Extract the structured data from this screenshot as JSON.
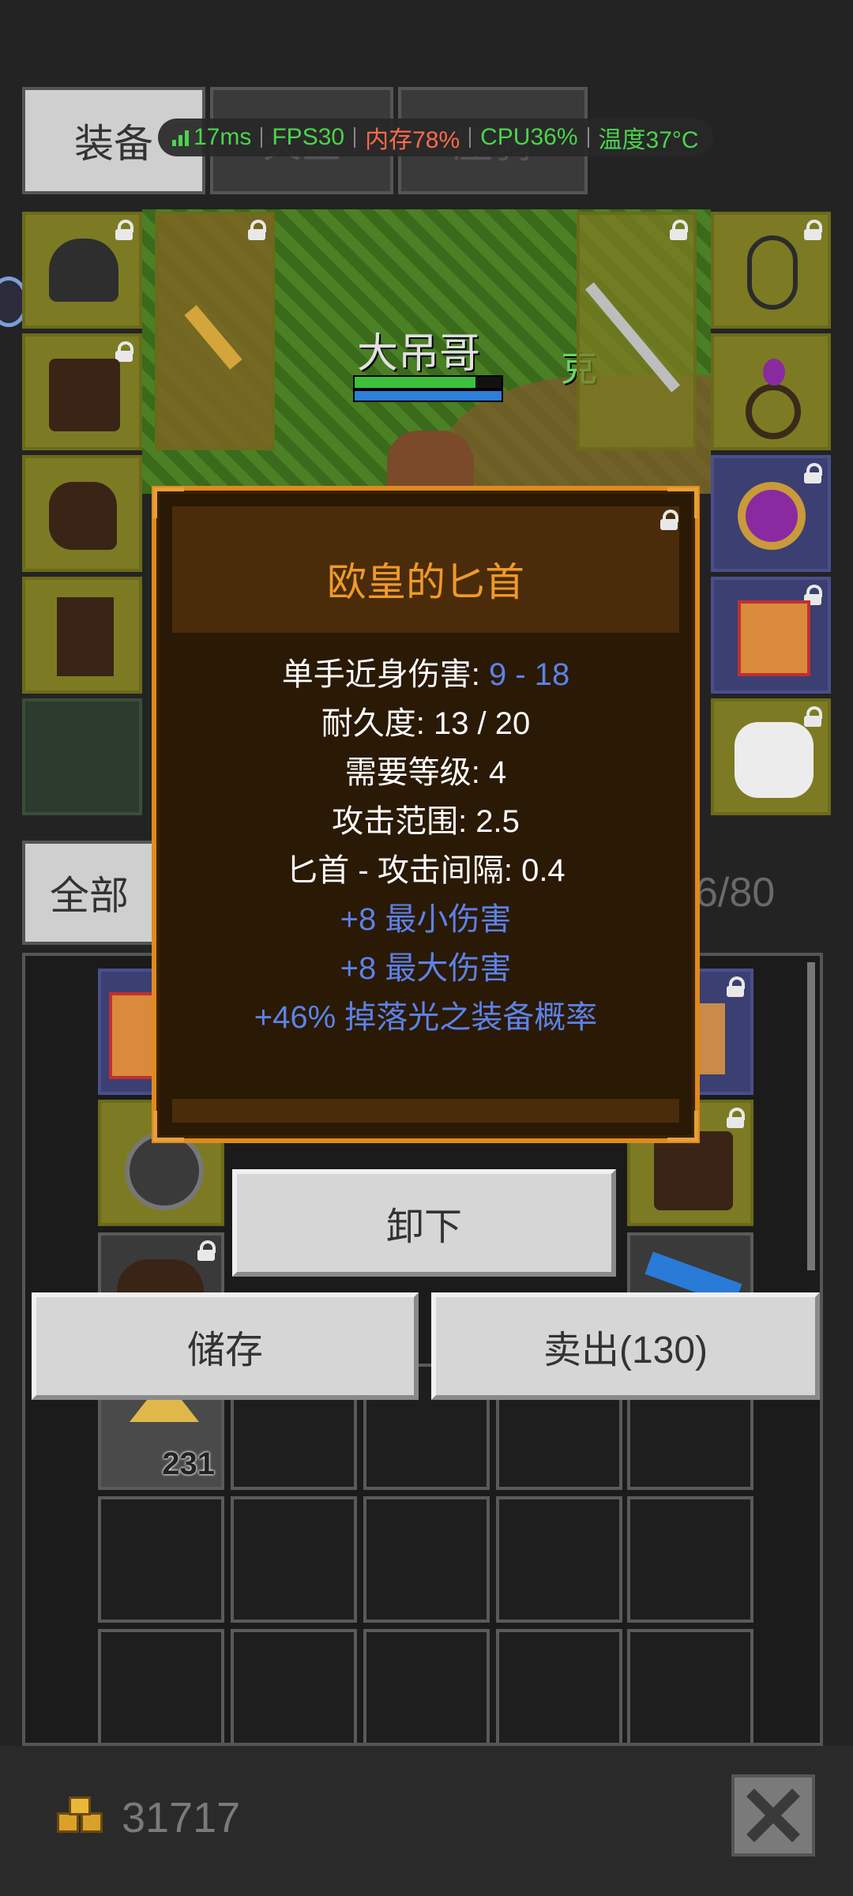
{
  "tabs": [
    {
      "label": "装备"
    },
    {
      "label": "火宝"
    },
    {
      "label": "座骑"
    }
  ],
  "perf": {
    "ping": "17ms",
    "fps": "FPS30",
    "memory": "内存78%",
    "cpu": "CPU36%",
    "temp": "温度37°C"
  },
  "scene": {
    "player_name": "大吊哥",
    "hp_fraction": 0.82,
    "mp_fraction": 1.0,
    "npc_partial": "克"
  },
  "tooltip": {
    "title": "欧皇的匕首",
    "stats": [
      {
        "label": "单手近身伤害: ",
        "value": "9 - 18"
      },
      {
        "label": "耐久度: 13 / 20",
        "value": ""
      },
      {
        "label": "需要等级: 4",
        "value": ""
      },
      {
        "label": "攻击范围: 2.5",
        "value": ""
      },
      {
        "label": "匕首 - 攻击间隔: 0.4",
        "value": ""
      }
    ],
    "bonuses": [
      "+8 最小伤害",
      "+8 最大伤害",
      "+46% 掉落光之装备概率"
    ]
  },
  "filter": {
    "label": "全部",
    "capacity": "6/80"
  },
  "inventory": {
    "gold_stack_count": "231"
  },
  "actions": {
    "unequip": "卸下",
    "store": "储存",
    "sell": "卖出(130)"
  },
  "footer": {
    "gold": "31717"
  },
  "colors": {
    "accent_orange": "#f0992a",
    "stat_blue": "#5c82e6",
    "frame": "#e08a1e"
  }
}
